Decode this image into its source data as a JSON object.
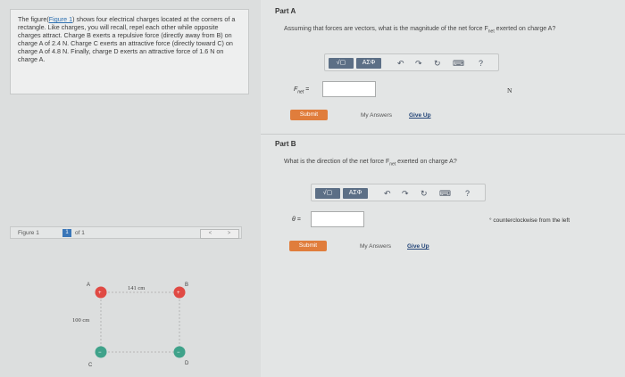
{
  "problem": {
    "pre": "The figure(",
    "fig_link": "Figure 1",
    "text": ") shows four electrical charges located at the corners of a rectangle. Like charges, you will recall, repel each other while opposite charges attract. Charge B exerts a repulsive force (directly away from B) on charge A of 2.4 N. Charge C exerts an attractive force (directly toward C) on charge A of 4.8 N. Finally, charge D exerts an attractive force of 1.6 N on charge A."
  },
  "figure_bar": {
    "label": "Figure 1",
    "number": "1",
    "of": "of 1",
    "prev": "<",
    "next": ">"
  },
  "figure": {
    "width_label": "141 cm",
    "height_label": "100 cm",
    "charges": [
      {
        "letter": "A",
        "color": "#e04a44"
      },
      {
        "letter": "B",
        "color": "#e04a44"
      },
      {
        "letter": "C",
        "color": "#3fa28a"
      },
      {
        "letter": "D",
        "color": "#3fa28a"
      }
    ]
  },
  "toolbar": {
    "sqrt": "√▢",
    "greek": "ΑΣΦ",
    "undo": "↶",
    "redo": "↷",
    "reset": "↻",
    "keyboard": "⌨",
    "help": "?"
  },
  "part_a": {
    "title": "Part A",
    "question_pre": "Assuming that forces are vectors, what is the magnitude of the net force F",
    "question_sub": "net",
    "question_post": " exerted on charge A?",
    "answer_label": "F",
    "answer_sub": "net",
    "answer_eq": " =",
    "value": "",
    "unit": "N",
    "submit": "Submit",
    "my_answers": "My Answers",
    "give_up": "Give Up"
  },
  "part_b": {
    "title": "Part B",
    "question_pre": "What is the direction of the net force F",
    "question_sub": "net",
    "question_post": " exerted on charge A?",
    "answer_label": "θ =",
    "value": "",
    "unit": "° counterclockwise from the left",
    "submit": "Submit",
    "my_answers": "My Answers",
    "give_up": "Give Up"
  }
}
